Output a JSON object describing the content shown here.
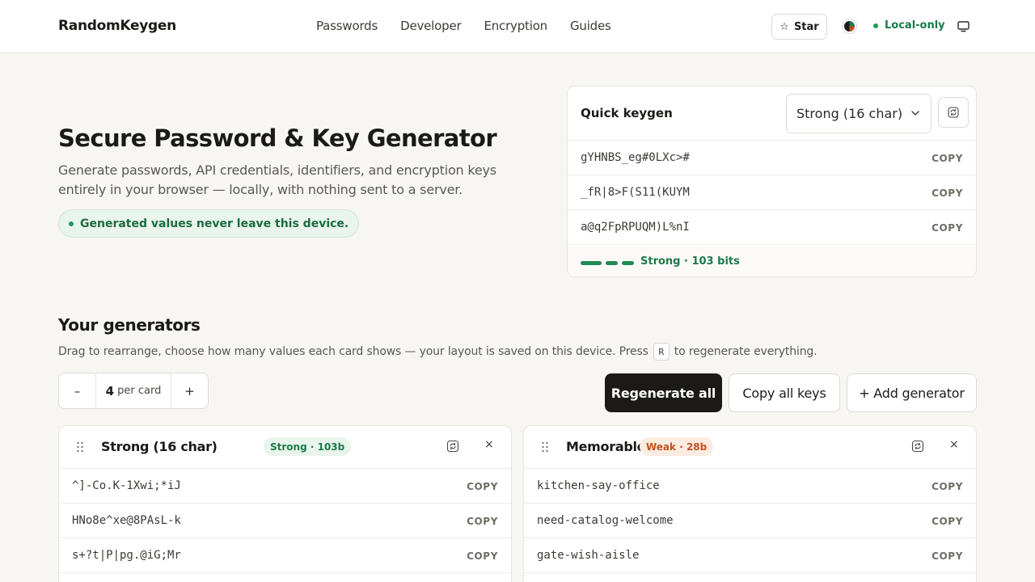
{
  "header": {
    "brand": "RandomKeygen",
    "nav": [
      "Passwords",
      "Developer",
      "Encryption",
      "Guides"
    ],
    "star_label": "Star",
    "status_label": "Local-only",
    "status_color": "#1f9a5c"
  },
  "hero": {
    "title": "Secure Password & Key Generator",
    "subtitle": "Generate passwords, API credentials, identifiers, and encryption keys entirely in your browser — locally, with nothing sent to a server.",
    "pill": "Generated values never leave this device."
  },
  "quick_keygen": {
    "title": "Quick keygen",
    "selected_option": "Strong (16 char)",
    "values": [
      "gYHNBS_eg#0LXc>#",
      "_fR|8>F(S11(KUYM",
      "a@q2FpRPUQM)L%nI"
    ],
    "copy_label": "COPY",
    "strength_text": "Strong · 103 bits",
    "strength_color": "#1f8a56"
  },
  "generators": {
    "title": "Your generators",
    "subtitle_before": "Drag to rearrange, choose how many values each card shows — your layout is saved on this device. Press",
    "shortcut_key": "R",
    "subtitle_after": "to regenerate everything.",
    "stepper_minus": "–",
    "stepper_count": "4",
    "stepper_unit": "per card",
    "stepper_plus": "+",
    "regenerate_all": "Regenerate all",
    "copy_all": "Copy all keys",
    "add_generator": "+ Add generator",
    "cards": [
      {
        "name": "Strong (16 char)",
        "badge": "Strong · 103b",
        "values": [
          "^]-Co.K-1Xwi;*iJ",
          "HNo8e^xe@8PAsL-k",
          "s+?t|P|pg.@iG;Mr"
        ],
        "copy_label": "COPY",
        "close": "×"
      },
      {
        "name": "Memorable",
        "badge": "Weak · 28b",
        "values": [
          "kitchen-say-office",
          "need-catalog-welcome",
          "gate-wish-aisle"
        ],
        "copy_label": "COPY",
        "close": "×"
      }
    ]
  }
}
